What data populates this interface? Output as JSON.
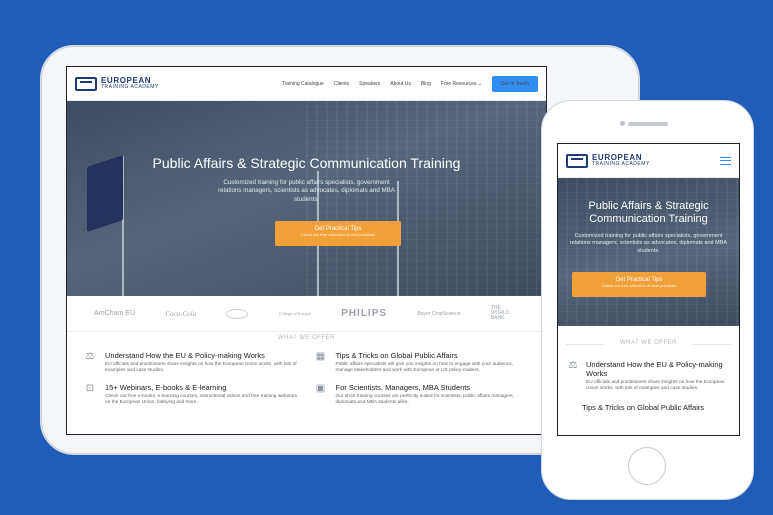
{
  "colors": {
    "background": "#1f5db8",
    "accent": "#2f8ef0",
    "cta": "#f2a13a",
    "logo": "#1f3b78"
  },
  "logo": {
    "line1": "EUROPEAN",
    "line2": "TRAINING ACADEMY"
  },
  "nav": {
    "links": [
      "Training Catalogue",
      "Clients",
      "Speakers",
      "About Us",
      "Blog",
      "Free Resources ⌄"
    ],
    "cta": "Get in Touch"
  },
  "hero": {
    "title": "Public Affairs & Strategic Communication Training",
    "subtitle": "Customized training for public affairs specialists, government relations managers, scientists as advocates, diplomats and MBA students.",
    "button_main": "Get Practical Tips",
    "button_sub": "Check our free collection of best practices"
  },
  "clients": [
    "AmCham EU",
    "Coca-Cola",
    "",
    "College of Europe",
    "PHILIPS",
    "Bayer CropScience",
    "THE WORLD BANK"
  ],
  "offer": {
    "title": "WHAT WE OFFER",
    "items": [
      {
        "icon": "scales-icon",
        "title": "Understand How the EU & Policy-making Works",
        "text": "EU officials and practitioners share insights on how the European Union works, with lots of examples and case studies."
      },
      {
        "icon": "building-icon",
        "title": "Tips & Tricks on Global Public Affairs",
        "text": "Public affairs specialists will give you insights on how to engage with your audience, manage stakeholders and work with European or US policy-makers."
      },
      {
        "icon": "presentation-icon",
        "title": "15+ Webinars, E-books & E-learning",
        "text": "Check our free e-books, e-learning courses, instructional videos and free training webinars on the European Union, lobbying and more."
      },
      {
        "icon": "briefcase-icon",
        "title": "For Scientists, Managers, MBA Students",
        "text": "Our short training courses are perfectly suited for scientists, public affairs managers, diplomats and MBA students alike."
      }
    ]
  },
  "phone": {
    "hero_title": "Public Affairs & Strategic Communication Training",
    "subtitle": "Customized training for public affairs specialists, government relations managers, scientists as advocates, diplomats and MBA students.",
    "peek": "Tips & Tricks on Global Public Affairs"
  }
}
